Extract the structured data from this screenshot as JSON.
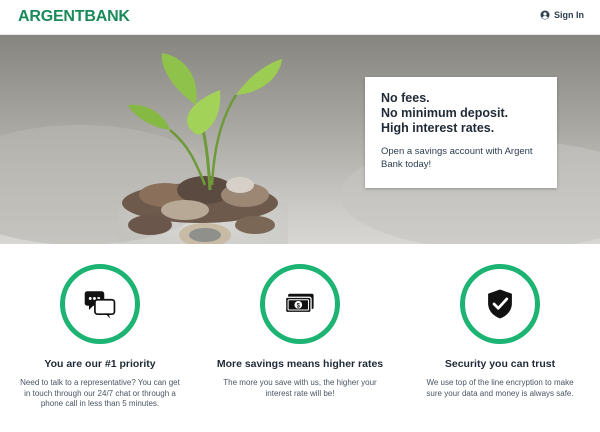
{
  "header": {
    "logo_text_1": "ARGENT",
    "logo_text_2": "BANK",
    "signin_label": "Sign In",
    "signin_icon": "user-circle-icon",
    "brand_color": "#1a8a5a"
  },
  "hero": {
    "headline_lines": [
      "No fees.",
      "No minimum deposit.",
      "High interest rates."
    ],
    "body": "Open a savings account with Argent Bank today!"
  },
  "features": [
    {
      "icon": "chat-bubbles-icon",
      "title": "You are our #1 priority",
      "description": "Need to talk to a representative? You can get in touch through our 24/7 chat or through a phone call in less than 5 minutes."
    },
    {
      "icon": "money-icon",
      "title": "More savings means higher rates",
      "description": "The more you save with us, the higher your interest rate will be!"
    },
    {
      "icon": "shield-check-icon",
      "title": "Security you can trust",
      "description": "We use top of the line encryption to make sure your data and money is always safe."
    }
  ],
  "colors": {
    "accent": "#1db373",
    "text_dark": "#1f2a36"
  }
}
